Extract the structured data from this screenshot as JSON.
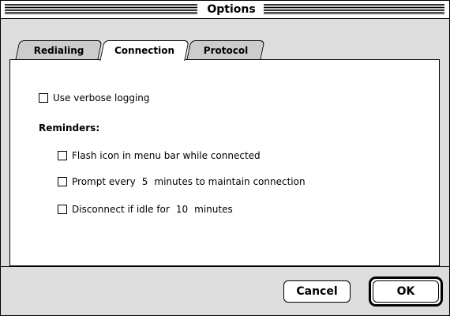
{
  "window": {
    "title": "Options"
  },
  "tabs": [
    {
      "label": "Redialing",
      "selected": false
    },
    {
      "label": "Connection",
      "selected": true
    },
    {
      "label": "Protocol",
      "selected": false
    }
  ],
  "connection": {
    "verbose_logging": {
      "label": "Use verbose logging",
      "checked": false
    },
    "reminders_heading": "Reminders:",
    "flash_icon": {
      "label": "Flash icon in menu bar while connected",
      "checked": false
    },
    "prompt_every": {
      "prefix": "Prompt every",
      "value": "5",
      "suffix": "minutes to maintain connection",
      "checked": false
    },
    "disconnect_idle": {
      "prefix": "Disconnect if idle for",
      "value": "10",
      "suffix": "minutes",
      "checked": false
    }
  },
  "buttons": {
    "cancel": "Cancel",
    "ok": "OK"
  }
}
